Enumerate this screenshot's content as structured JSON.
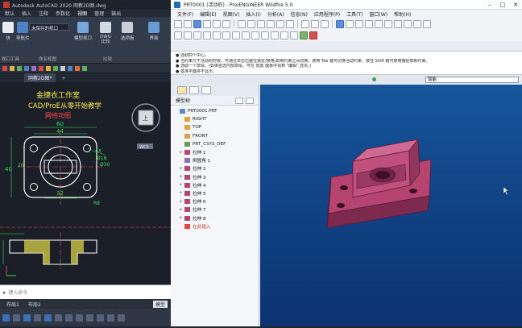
{
  "acad": {
    "title": "Autodesk AutoCAD 2020  网教2D图.dwg",
    "menu": [
      "默认",
      "插入",
      "注释",
      "参数化",
      "视图",
      "管理",
      "输出"
    ],
    "ribbon": {
      "combo_value": "未保存的视口",
      "btn_block": "块",
      "btn_nav": "导航栏",
      "btn_model_viewport": "模型视口",
      "btn_dwg": "DWG\n比较",
      "btn_palette": "选项板",
      "btn_ui": "界面",
      "group_tools": "视口工具",
      "group_named": "命名视图",
      "group_compare": "比较"
    },
    "tabs": [
      "网教2D图*"
    ],
    "drawing": {
      "heading1": "金捷衣工作室",
      "heading2": "CAD/ProE从零开始教学",
      "heading3": "网络功图",
      "dim_60": "60",
      "dim_44": "44",
      "dim_32": "32",
      "dim_40": "40",
      "dim_20_side": "20",
      "dim_d18": "Ø18",
      "dim_d30": "Ø30",
      "dim_r8": "R8",
      "dim_4x": "4X",
      "view_cube_label": "上",
      "wcs": "WCS"
    },
    "command_placeholder": "键入命令",
    "layout_tabs": [
      "布局1",
      "布局2"
    ],
    "model_tab": "模型"
  },
  "proe": {
    "title": "PRT0001 (活动的) - Pro/ENGINEER Wildfire 5.0",
    "menu": [
      "文件(F)",
      "编辑(E)",
      "视图(V)",
      "插入(I)",
      "分析(A)",
      "信息(N)",
      "应用程序(P)",
      "工具(T)",
      "窗口(W)",
      "帮助(H)"
    ],
    "messages": [
      "● 选取四个中心。",
      "● 当约束元干活动的时候，可通过单击右键在锁定/禁用/启用约束之间切换。使用 Tab 键可切换活动约束。按住 Shift 键可禁用捕捉到新约束。",
      "● 选取一个草绘。(如果首选内部草绘，可在 放置 面板中找到 \"编辑\" 选项。)",
      "● 基准平面将不显示。"
    ],
    "filter_value": "智能",
    "model_tree_label": "模型树",
    "tree_items": [
      {
        "label": "PRT0001.PRT",
        "icon": "part",
        "exp": ""
      },
      {
        "label": "RIGHT",
        "icon": "plane",
        "exp": ""
      },
      {
        "label": "TOP",
        "icon": "plane",
        "exp": ""
      },
      {
        "label": "FRONT",
        "icon": "plane",
        "exp": ""
      },
      {
        "label": "PRT_CSYS_DEF",
        "icon": "csys",
        "exp": ""
      },
      {
        "label": "拉伸 1",
        "icon": "extrude",
        "exp": "+"
      },
      {
        "label": "倒圆角 1",
        "icon": "round",
        "exp": ""
      },
      {
        "label": "拉伸 2",
        "icon": "extrude",
        "exp": "+"
      },
      {
        "label": "拉伸 3",
        "icon": "extrude",
        "exp": "+"
      },
      {
        "label": "拉伸 4",
        "icon": "extrude",
        "exp": "+"
      },
      {
        "label": "拉伸 5",
        "icon": "extrude",
        "exp": "+"
      },
      {
        "label": "拉伸 6",
        "icon": "extrude",
        "exp": "+"
      },
      {
        "label": "拉伸 7",
        "icon": "extrude",
        "exp": "+"
      },
      {
        "label": "拉伸 8",
        "icon": "extrude",
        "exp": "+"
      },
      {
        "label": "在此插入",
        "icon": "insert",
        "exp": ""
      }
    ],
    "colors": {
      "part": "#b5446f",
      "graphics_bg_top": "#17569c",
      "graphics_bg_bottom": "#0b3470"
    }
  }
}
